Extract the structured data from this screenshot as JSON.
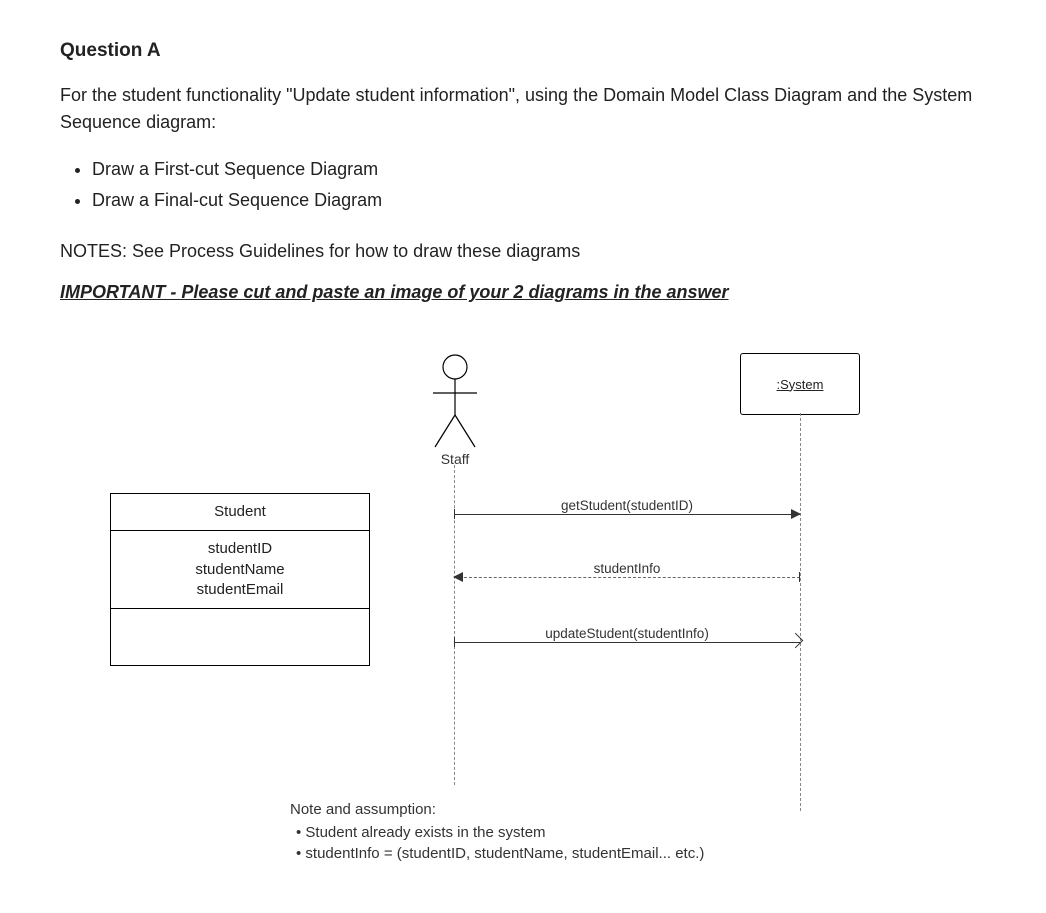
{
  "question_title": "Question A",
  "intro": "For the student functionality \"Update student information\", using the Domain Model Class Diagram and the System Sequence diagram:",
  "bullets": [
    "Draw a First-cut Sequence Diagram",
    "Draw a Final-cut Sequence Diagram"
  ],
  "notes_line": "NOTES:  See Process Guidelines for how to draw these diagrams",
  "important_line": "IMPORTANT - Please cut and paste an image of your 2 diagrams in the answer",
  "diagram": {
    "actor_label": "Staff",
    "system_label": ":System",
    "class": {
      "name": "Student",
      "attributes": [
        "studentID",
        "studentName",
        "studentEmail"
      ]
    },
    "messages": {
      "m1": "getStudent(studentID)",
      "m2": "studentInfo",
      "m3": "updateStudent(studentInfo)"
    },
    "notes": {
      "title": "Note and assumption:",
      "items": [
        "Student already exists in the system",
        "studentInfo = (studentID, studentName, studentEmail... etc.)"
      ]
    }
  }
}
